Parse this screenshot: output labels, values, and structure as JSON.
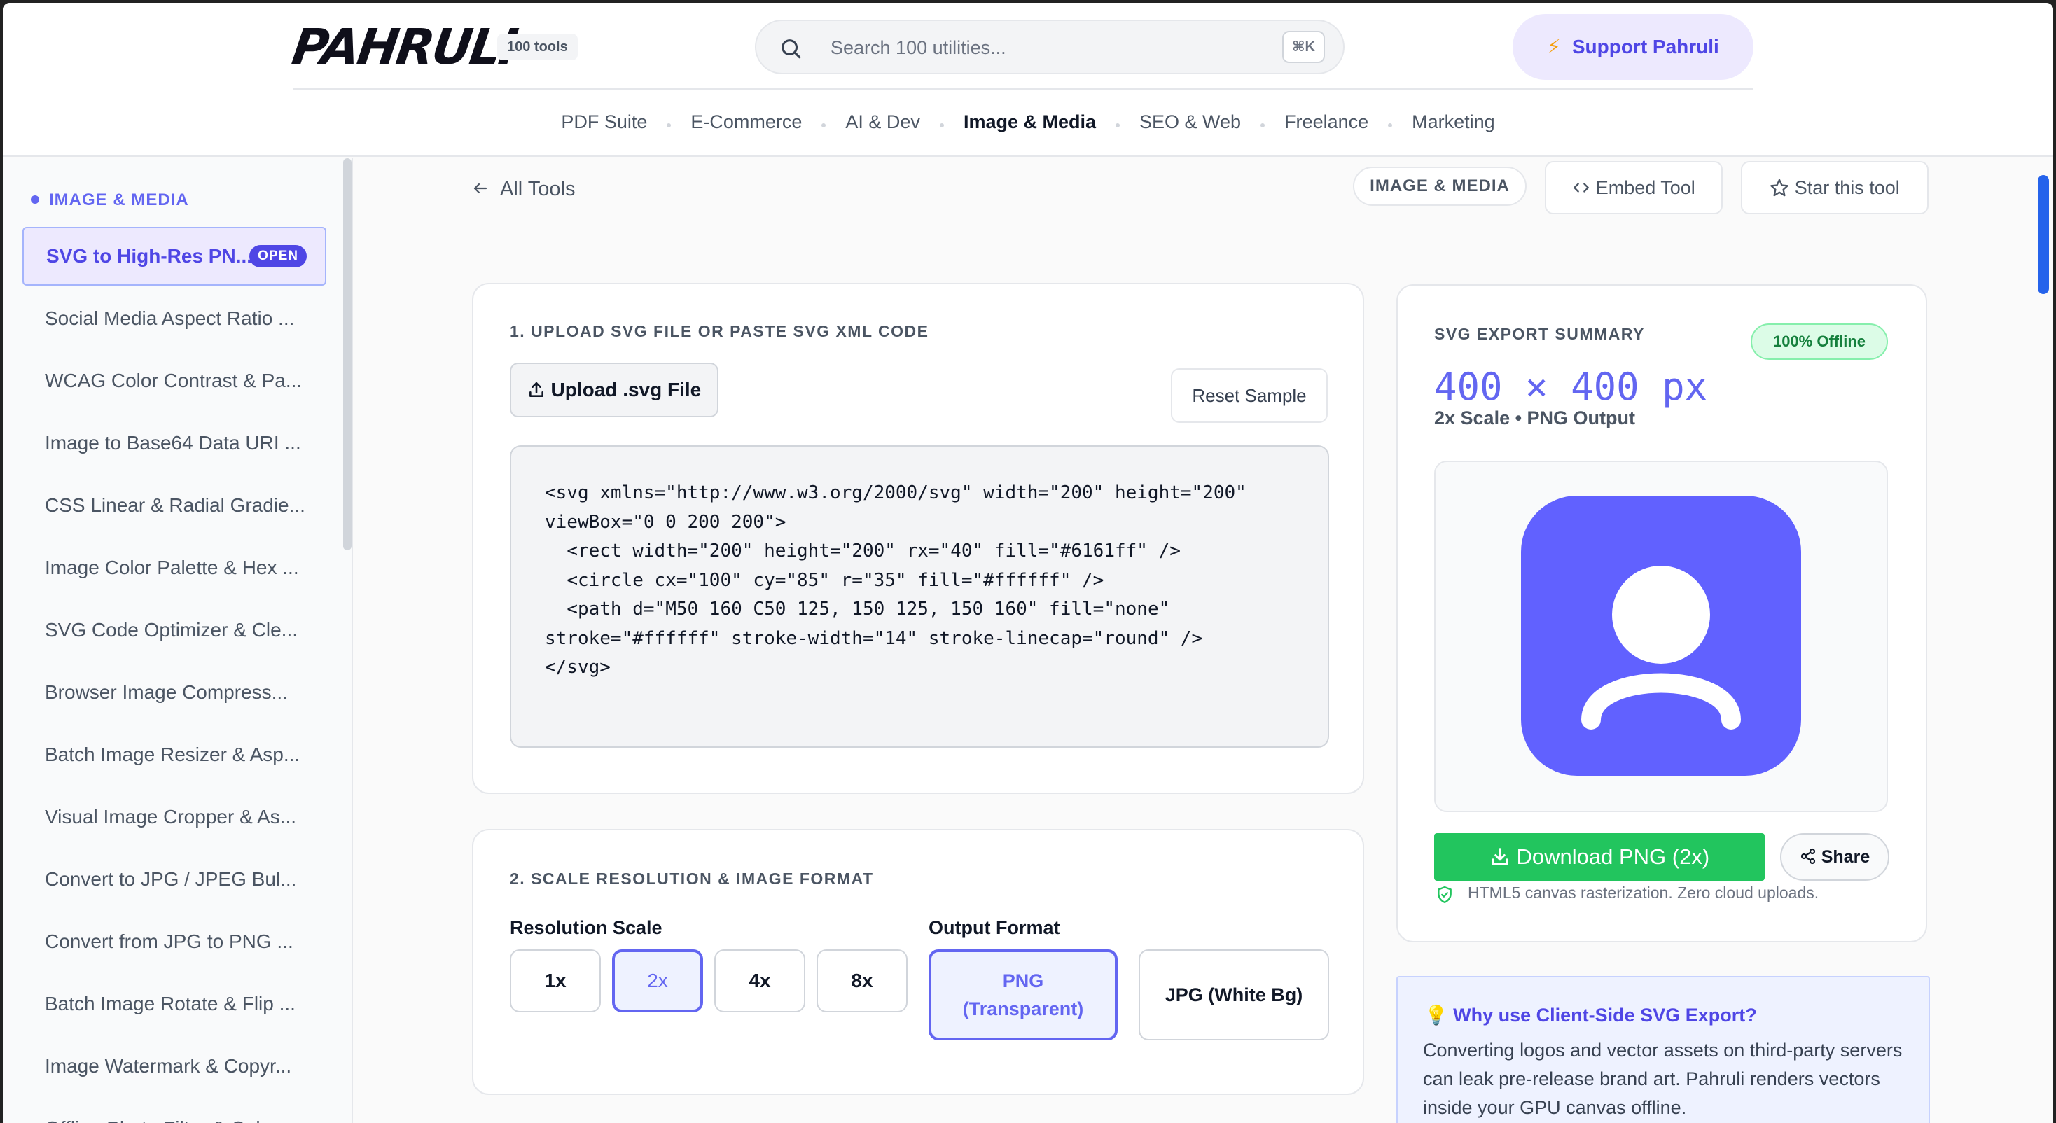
{
  "header": {
    "logo": "PAHRULI",
    "tools_badge": "100 tools",
    "search_placeholder": "Search 100 utilities...",
    "search_shortcut": "⌘K",
    "support_label": "Support Pahruli",
    "nav": [
      "PDF Suite",
      "E-Commerce",
      "AI & Dev",
      "Image & Media",
      "SEO & Web",
      "Freelance",
      "Marketing"
    ],
    "nav_active": "Image & Media"
  },
  "sidebar": {
    "heading": "IMAGE & MEDIA",
    "active_badge": "OPEN",
    "items": [
      "SVG to High-Res PN...",
      "Social Media Aspect Ratio ...",
      "WCAG Color Contrast & Pa...",
      "Image to Base64 Data URI ...",
      "CSS Linear & Radial Gradie...",
      "Image Color Palette & Hex ...",
      "SVG Code Optimizer & Cle...",
      "Browser Image Compress...",
      "Batch Image Resizer & Asp...",
      "Visual Image Cropper & As...",
      "Convert to JPG / JPEG Bul...",
      "Convert from JPG to PNG ...",
      "Batch Image Rotate & Flip ...",
      "Image Watermark & Copyr...",
      "Offline Photo Filter & Col..."
    ]
  },
  "toolbar": {
    "back_label": "All Tools",
    "category_pill": "IMAGE & MEDIA",
    "embed_label": "Embed Tool",
    "star_label": "Star this tool"
  },
  "upload_card": {
    "title": "1. UPLOAD SVG FILE OR PASTE SVG XML CODE",
    "upload_label": "Upload .svg File",
    "reset_label": "Reset Sample",
    "code": "<svg xmlns=\"http://www.w3.org/2000/svg\" width=\"200\" height=\"200\" viewBox=\"0 0 200 200\">\n  <rect width=\"200\" height=\"200\" rx=\"40\" fill=\"#6161ff\" />\n  <circle cx=\"100\" cy=\"85\" r=\"35\" fill=\"#ffffff\" />\n  <path d=\"M50 160 C50 125, 150 125, 150 160\" fill=\"none\" stroke=\"#ffffff\" stroke-width=\"14\" stroke-linecap=\"round\" />\n</svg>"
  },
  "scale_card": {
    "title": "2. SCALE RESOLUTION & IMAGE FORMAT",
    "resolution_label": "Resolution Scale",
    "scales": [
      "1x",
      "2x",
      "4x",
      "8x"
    ],
    "active_scale": "2x",
    "format_label": "Output Format",
    "formats": [
      "PNG (Transparent)",
      "JPG (White Bg)"
    ],
    "active_format": "PNG (Transparent)"
  },
  "summary": {
    "title": "SVG EXPORT SUMMARY",
    "offline_badge": "100% Offline",
    "dimensions": "400 × 400 px",
    "scale_output": "2x Scale • PNG Output",
    "download_label": "Download PNG (2x)",
    "share_label": "Share",
    "note": "HTML5 canvas rasterization. Zero cloud uploads."
  },
  "why": {
    "title": "Why use Client-Side SVG Export?",
    "body": "Converting logos and vector assets on third-party servers can leak pre-release brand art. Pahruli renders vectors inside your GPU canvas offline."
  },
  "colors": {
    "accent": "#6366f1",
    "preview_fill": "#6161ff",
    "download": "#22c55e"
  }
}
